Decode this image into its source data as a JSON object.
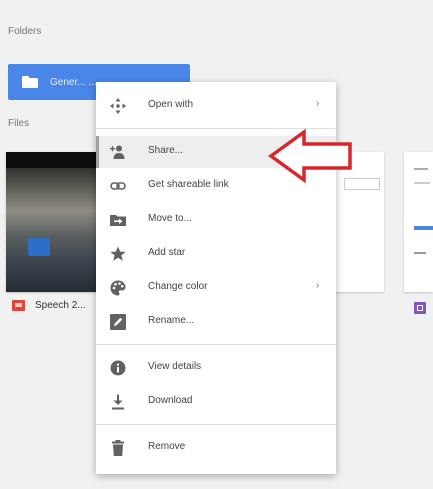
{
  "sections": {
    "folders_label": "Folders",
    "files_label": "Files"
  },
  "folder": {
    "name": "Gener... ...",
    "color": "#4a86e8"
  },
  "files": [
    {
      "name": "Speech 2...",
      "icon": "slides-icon"
    },
    {
      "name": "",
      "icon": "file-thumbnail"
    },
    {
      "name": "",
      "icon": "form-icon"
    }
  ],
  "context_menu": {
    "items": [
      {
        "label": "Open with",
        "icon": "open-with-icon",
        "submenu": "›"
      },
      {
        "label": "Share...",
        "icon": "share-icon",
        "selected": true
      },
      {
        "label": "Get shareable link",
        "icon": "link-icon"
      },
      {
        "label": "Move to...",
        "icon": "move-to-folder-icon"
      },
      {
        "label": "Add star",
        "icon": "star-icon"
      },
      {
        "label": "Change color",
        "icon": "palette-icon",
        "submenu": "›"
      },
      {
        "label": "Rename...",
        "icon": "pencil-icon"
      },
      {
        "label": "View details",
        "icon": "info-icon"
      },
      {
        "label": "Download",
        "icon": "download-icon"
      },
      {
        "label": "Remove",
        "icon": "trash-icon"
      }
    ]
  },
  "annotation": {
    "type": "red-arrow",
    "color": "#d9262c",
    "points_to": "Share..."
  }
}
